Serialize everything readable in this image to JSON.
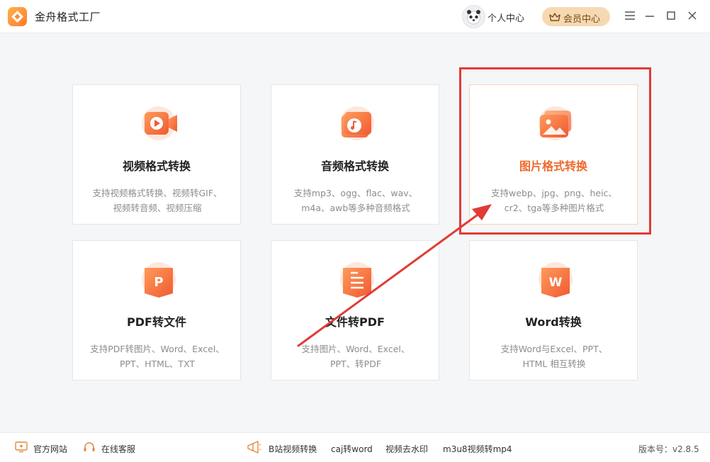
{
  "titlebar": {
    "app_title": "金舟格式工厂",
    "personal_center": "个人中心",
    "vip_center": "会员中心",
    "icons": [
      "app-logo-icon",
      "avatar-icon",
      "crown-icon",
      "menu-icon",
      "minimize-icon",
      "maximize-icon",
      "close-icon"
    ]
  },
  "cards": [
    {
      "title": "视频格式转换",
      "desc": [
        "支持视频格式转换、视频转GIF、",
        "视频转音频、视频压缩"
      ],
      "icon": "video-icon"
    },
    {
      "title": "音频格式转换",
      "desc": [
        "支持mp3、ogg、flac、wav、",
        "m4a、awb等多种音频格式"
      ],
      "icon": "music-icon"
    },
    {
      "title": "图片格式转换",
      "desc": [
        "支持webp、jpg、png、heic、",
        "cr2、tga等多种图片格式"
      ],
      "icon": "image-icon",
      "selected": true
    },
    {
      "title": "PDF转文件",
      "desc": [
        "支持PDF转图片、Word、Excel、",
        "PPT、HTML、TXT"
      ],
      "icon": "pdf-icon"
    },
    {
      "title": "文件转PDF",
      "desc": [
        "支持图片、Word、Excel、",
        "PPT、转PDF"
      ],
      "icon": "document-icon"
    },
    {
      "title": "Word转换",
      "desc": [
        "支持Word与Excel、PPT、",
        "HTML 相互转换"
      ],
      "icon": "word-icon"
    }
  ],
  "colors": {
    "accent": "#ee6a2e",
    "highlight_border": "#e03b36",
    "icon_gradient": [
      "#ff9a5a",
      "#f05a32"
    ]
  },
  "footer": {
    "official_site": "官方网站",
    "online_service": "在线客服",
    "links": [
      "B站视频转换",
      "caj转word",
      "视频去水印",
      "m3u8视频转mp4"
    ],
    "version": "版本号：v2.8.5"
  }
}
